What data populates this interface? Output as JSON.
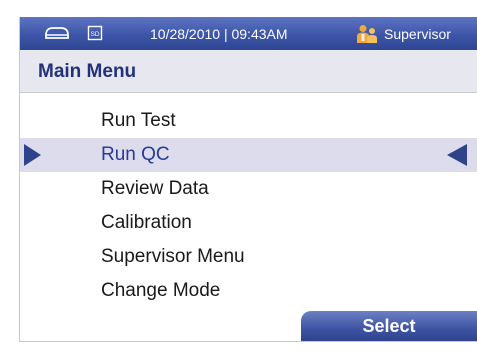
{
  "status_bar": {
    "icons": [
      "drive-icon",
      "sd-card-icon",
      "supervisor-icon"
    ],
    "sd_label": "SD",
    "datetime": "10/28/2010 | 09:43AM",
    "user": "Supervisor"
  },
  "header": {
    "title": "Main Menu"
  },
  "menu": {
    "items": [
      {
        "label": "Run Test",
        "selected": false
      },
      {
        "label": "Run QC",
        "selected": true
      },
      {
        "label": "Review Data",
        "selected": false
      },
      {
        "label": "Calibration",
        "selected": false
      },
      {
        "label": "Supervisor Menu",
        "selected": false
      },
      {
        "label": "Change Mode",
        "selected": false
      }
    ]
  },
  "footer": {
    "select_label": "Select"
  },
  "colors": {
    "status_bar": "#3d55a8",
    "title_text": "#23327a",
    "selection_bg": "#dcdcec",
    "arrow": "#2e4389"
  }
}
